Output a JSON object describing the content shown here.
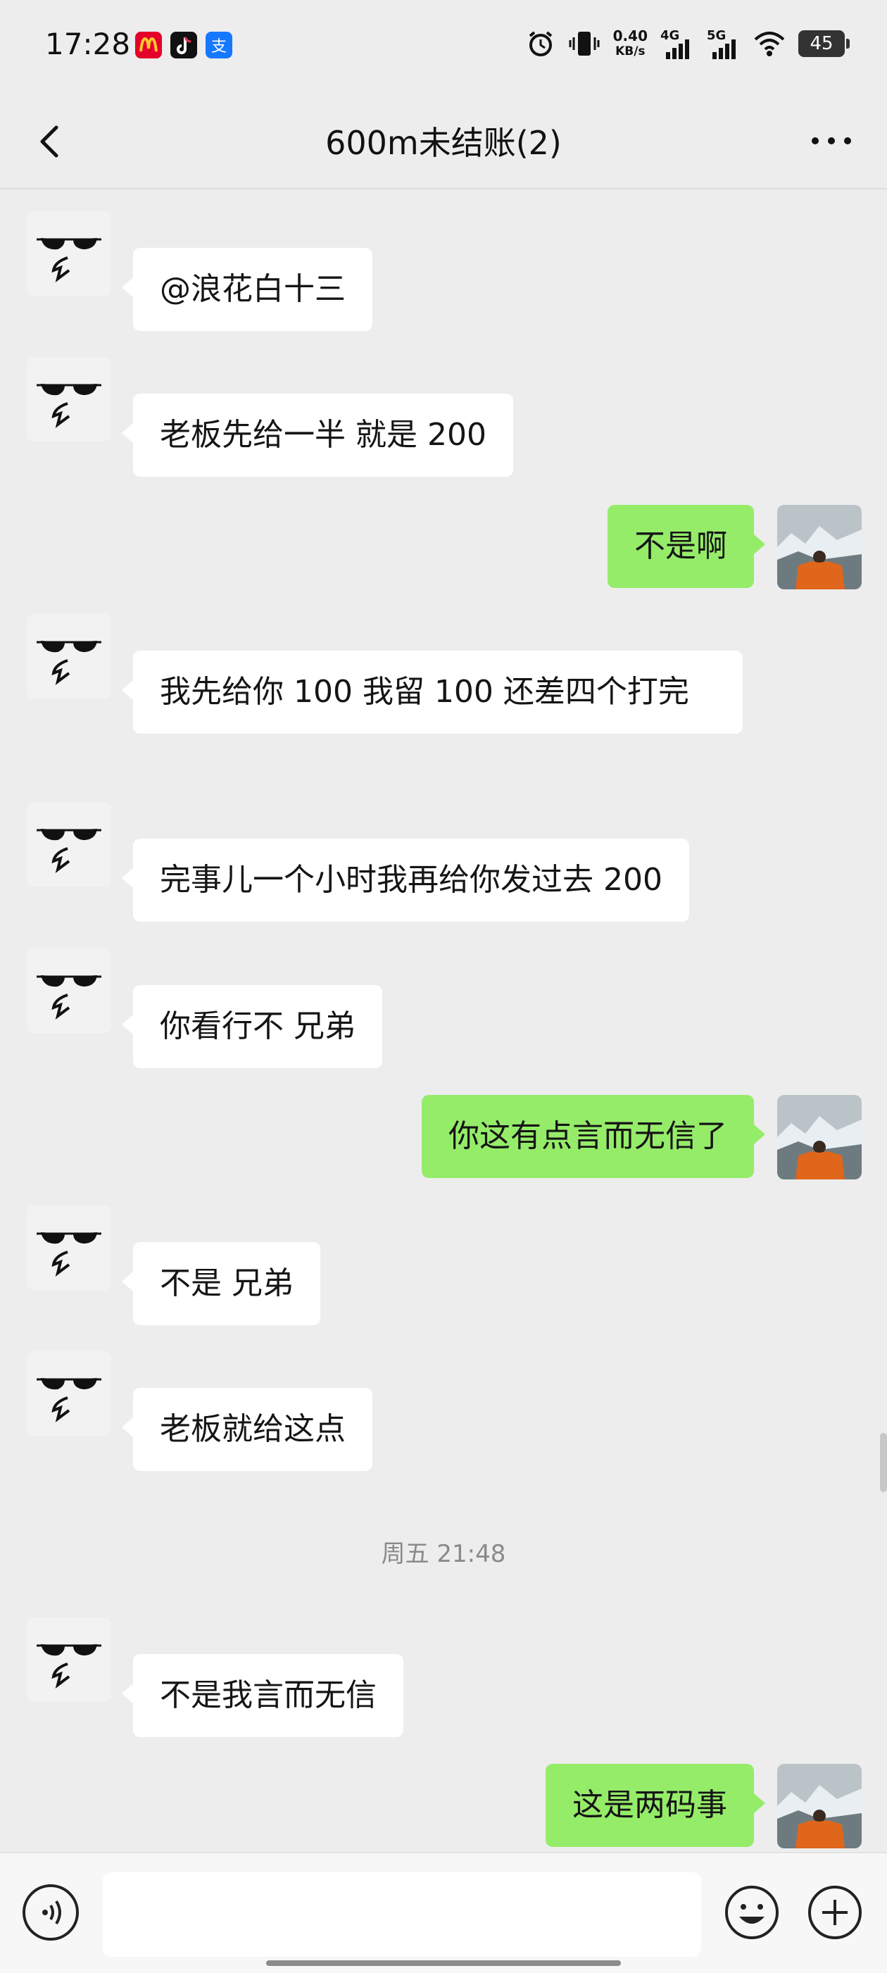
{
  "status_bar": {
    "time": "17:28",
    "apps": [
      "mcdonalds-icon",
      "douyin-icon",
      "alipay-icon"
    ],
    "speed_value": "0.40",
    "speed_unit": "KB/s",
    "network_1": "4G",
    "network_2": "5G",
    "battery": "45"
  },
  "header": {
    "title": "600m未结账(2)"
  },
  "messages": [
    {
      "side": "left",
      "text": "@浪花白十三"
    },
    {
      "side": "left",
      "text": "老板先给一半 就是 200"
    },
    {
      "side": "right",
      "text": "不是啊"
    },
    {
      "side": "left",
      "text": "我先给你 100 我留 100 还差四个打完"
    },
    {
      "side": "left",
      "text": "完事儿一个小时我再给你发过去 200"
    },
    {
      "side": "left",
      "text": "你看行不 兄弟"
    },
    {
      "side": "right",
      "text": "你这有点言而无信了"
    },
    {
      "side": "left",
      "text": "不是 兄弟"
    },
    {
      "side": "left",
      "text": "老板就给这点"
    },
    {
      "side": "left",
      "text": "不是我言而无信"
    },
    {
      "side": "right",
      "text": "这是两码事"
    }
  ],
  "timestamp": "周五 21:48",
  "input": {
    "value": "",
    "placeholder": ""
  },
  "colors": {
    "background": "#ededed",
    "outgoing_bubble": "#95ec69",
    "incoming_bubble": "#ffffff"
  }
}
